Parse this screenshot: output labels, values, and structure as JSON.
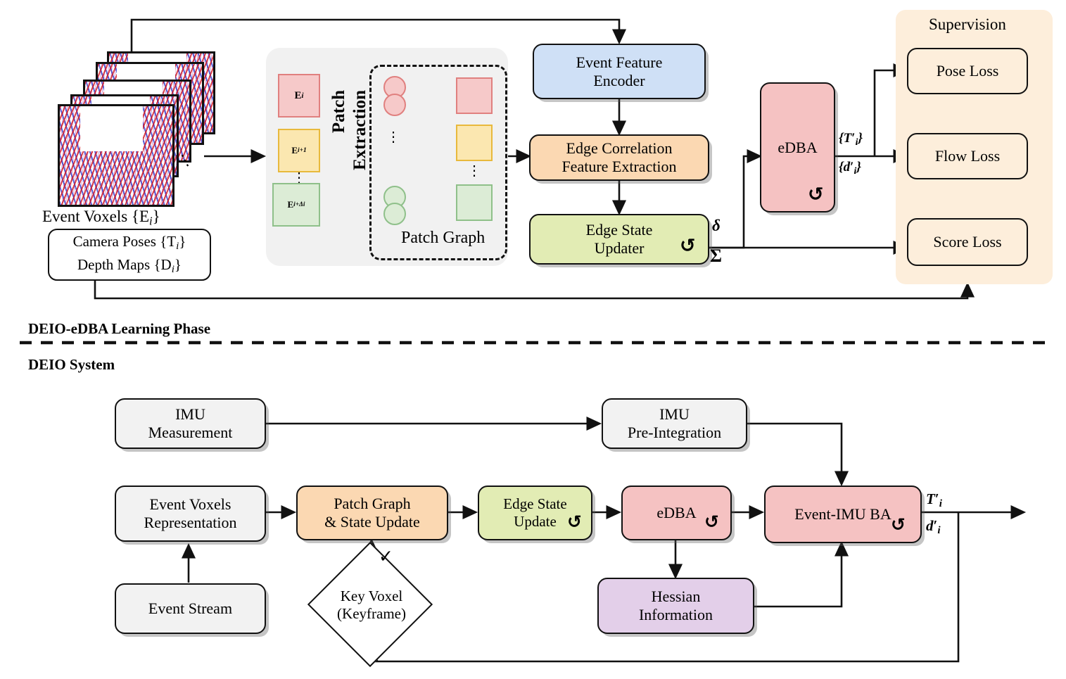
{
  "sections": {
    "learning_phase": "DEIO-eDBA Learning Phase",
    "system": "DEIO System"
  },
  "top": {
    "voxels_caption": "Event Voxels {E",
    "voxels_caption_sub": "i",
    "voxels_caption_end": "}",
    "inputs_box": {
      "line1": "Camera Poses {T",
      "line1_sub": "i",
      "line1_end": "}",
      "line2": "Depth Maps {D",
      "line2_sub": "i",
      "line2_end": "}"
    },
    "patch_extraction_label": "Patch\nExtraction",
    "patch_extraction_l1": "Patch",
    "patch_extraction_l2": "Extraction",
    "patch_graph_label": "Patch Graph",
    "patch_inputs": [
      {
        "label": "E",
        "sub": "i",
        "color": "#f6c9c9",
        "border": "#e0807f"
      },
      {
        "label": "E",
        "sub": "i+1",
        "color": "#fbe7b0",
        "border": "#e8b93c"
      },
      {
        "label": "E",
        "sub": "i+Δi",
        "color": "#dcecd6",
        "border": "#8fc08a"
      }
    ],
    "blocks": [
      {
        "id": "event-feature-encoder",
        "l1": "Event Feature",
        "l2": "Encoder",
        "fill": "#cfe0f6",
        "stroke": "#111"
      },
      {
        "id": "edge-correlation",
        "l1": "Edge Correlation",
        "l2": "Feature Extraction",
        "fill": "#fbd8b2",
        "stroke": "#111"
      },
      {
        "id": "edge-state-updater",
        "l1": "Edge State",
        "l2": "Updater",
        "fill": "#e2ecb4",
        "stroke": "#111"
      },
      {
        "id": "edba",
        "l1": "eDBA",
        "l2": "",
        "fill": "#f5c2c2",
        "stroke": "#111"
      }
    ],
    "delta_label": "δ",
    "sigma_label": "Σ",
    "edba_out_pose": "{T",
    "edba_out_pose_sub": "i",
    "edba_out_depth": "{d",
    "edba_out_depth_sub": "i",
    "supervision_title": "Supervision",
    "supervision_fill": "#fdeedb",
    "losses": [
      "Pose Loss",
      "Flow Loss",
      "Score Loss"
    ],
    "loss_fill": "#fdeedb"
  },
  "bottom": {
    "blocks": [
      {
        "id": "imu-measurement",
        "l1": "IMU",
        "l2": "Measurement",
        "fill": "#f2f2f2"
      },
      {
        "id": "imu-preintegration",
        "l1": "IMU",
        "l2": "Pre-Integration",
        "fill": "#f2f2f2"
      },
      {
        "id": "event-voxels-representation",
        "l1": "Event Voxels",
        "l2": "Representation",
        "fill": "#f2f2f2"
      },
      {
        "id": "event-stream",
        "l1": "Event Stream",
        "l2": "",
        "fill": "#f2f2f2"
      },
      {
        "id": "patch-graph-state-update",
        "l1": "Patch Graph",
        "l2": "& State Update",
        "fill": "#fbd8b2"
      },
      {
        "id": "edge-state-update",
        "l1": "Edge State",
        "l2": "Update",
        "fill": "#e2ecb4"
      },
      {
        "id": "edba-system",
        "l1": "eDBA",
        "l2": "",
        "fill": "#f5c2c2"
      },
      {
        "id": "event-imu-ba",
        "l1": "Event-IMU BA",
        "l2": "",
        "fill": "#f5c2c2"
      },
      {
        "id": "hessian-information",
        "l1": "Hessian",
        "l2": "Information",
        "fill": "#e3cfe9"
      }
    ],
    "decision": {
      "l1": "Key Voxel",
      "l2": "(Keyframe)"
    },
    "check_mark": "✓",
    "out_pose": "T",
    "out_pose_sub": "i",
    "out_depth": "d",
    "out_depth_sub": "i"
  },
  "icons": {
    "loop": "↺",
    "dots_vertical": "⋮",
    "dots_diagonal": "⋰"
  },
  "colors": {
    "red_fill": "#f5c2c2",
    "red_stroke": "#e0807f",
    "yellow_fill": "#fbe7b0",
    "yellow_stroke": "#e8b93c",
    "green_fill": "#dcecd6",
    "green_stroke": "#8fc08a",
    "blue_fill": "#cfe0f6",
    "orange_fill": "#fbd8b2",
    "olive_fill": "#e2ecb4",
    "purple_fill": "#e3cfe9",
    "grey_fill": "#f2f2f2",
    "cream_fill": "#fdeedb",
    "line": "#111111"
  }
}
